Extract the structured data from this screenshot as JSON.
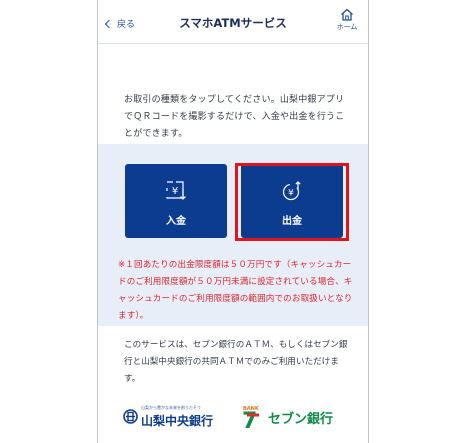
{
  "header": {
    "back_label": "戻る",
    "title": "スマホATMサービス",
    "home_label": "ホーム"
  },
  "intro_text": "お取引の種類をタップしてください。山梨中銀アプリでＱＲコードを撮影するだけで、入金や出金を行うことができます。",
  "actions": {
    "deposit_label": "入金",
    "withdraw_label": "出金"
  },
  "notice_text": "※１回あたりの出金限度額は５０万円です（キャッシュカードのご利用限度額が５０万円未満に設定されている場合、キャッシュカードのご利用限度額の範囲内でのお取扱いとなります）。",
  "service_text": "このサービスは、セブン銀行のＡＴＭ、もしくはセブン銀行と山梨中央銀行の共同ＡＴＭでのみご利用いただけます。",
  "logos": {
    "yamanashi_tagline": "山梨から豊かな未来を創りだそう",
    "yamanashi_name": "山梨中央銀行",
    "seven_name": "セブン銀行"
  },
  "colors": {
    "accent_blue": "#0c3c8f",
    "panel_bg": "#e8eef7",
    "notice_red": "#d8262f",
    "highlight_red": "#e0141c",
    "seven_green": "#0f8c48"
  },
  "icons": {
    "back": "chevron-left-icon",
    "home": "home-icon",
    "deposit": "yen-deposit-icon",
    "withdraw": "yen-withdraw-icon"
  }
}
